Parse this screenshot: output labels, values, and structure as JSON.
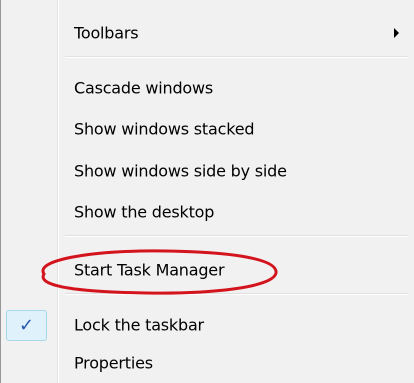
{
  "menu": {
    "items": [
      {
        "label": "Toolbars",
        "has_submenu": true
      },
      {
        "label": "Cascade windows"
      },
      {
        "label": "Show windows stacked"
      },
      {
        "label": "Show windows side by side"
      },
      {
        "label": "Show the desktop"
      },
      {
        "label": "Start Task Manager"
      },
      {
        "label": "Lock the taskbar",
        "checked": true
      },
      {
        "label": "Properties"
      }
    ],
    "check_glyph": "✓"
  },
  "annotation": {
    "ellipse_color": "#d4141c",
    "target_item": "Start Task Manager"
  },
  "colors": {
    "menu_background": "#f1f1f1",
    "check_color": "#2758b0"
  }
}
